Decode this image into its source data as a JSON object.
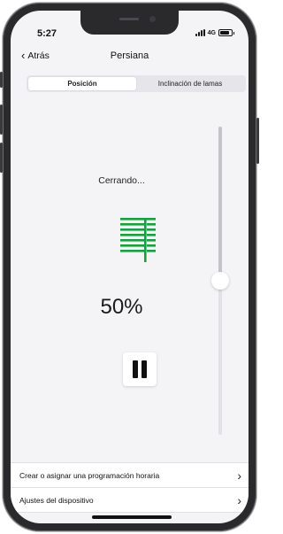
{
  "status_bar": {
    "time": "5:27",
    "network": "4G",
    "battery_level": 0.8
  },
  "nav": {
    "back_label": "Atrás",
    "back_icon": "chevron-left-icon",
    "title": "Persiana"
  },
  "tabs": [
    {
      "label": "Posición",
      "active": true
    },
    {
      "label": "Inclinación de lamas",
      "active": false
    }
  ],
  "control": {
    "status": "Cerrando...",
    "icon": "blind-icon",
    "icon_color": "#1a9e3f",
    "position_label": "50%",
    "position_value": 0.5,
    "pause_icon": "pause-icon"
  },
  "menu": [
    {
      "label": "Crear o asignar una programación horaria",
      "icon": "chevron-right-icon"
    },
    {
      "label": "Ajustes del dispositivo",
      "icon": "chevron-right-icon"
    }
  ]
}
